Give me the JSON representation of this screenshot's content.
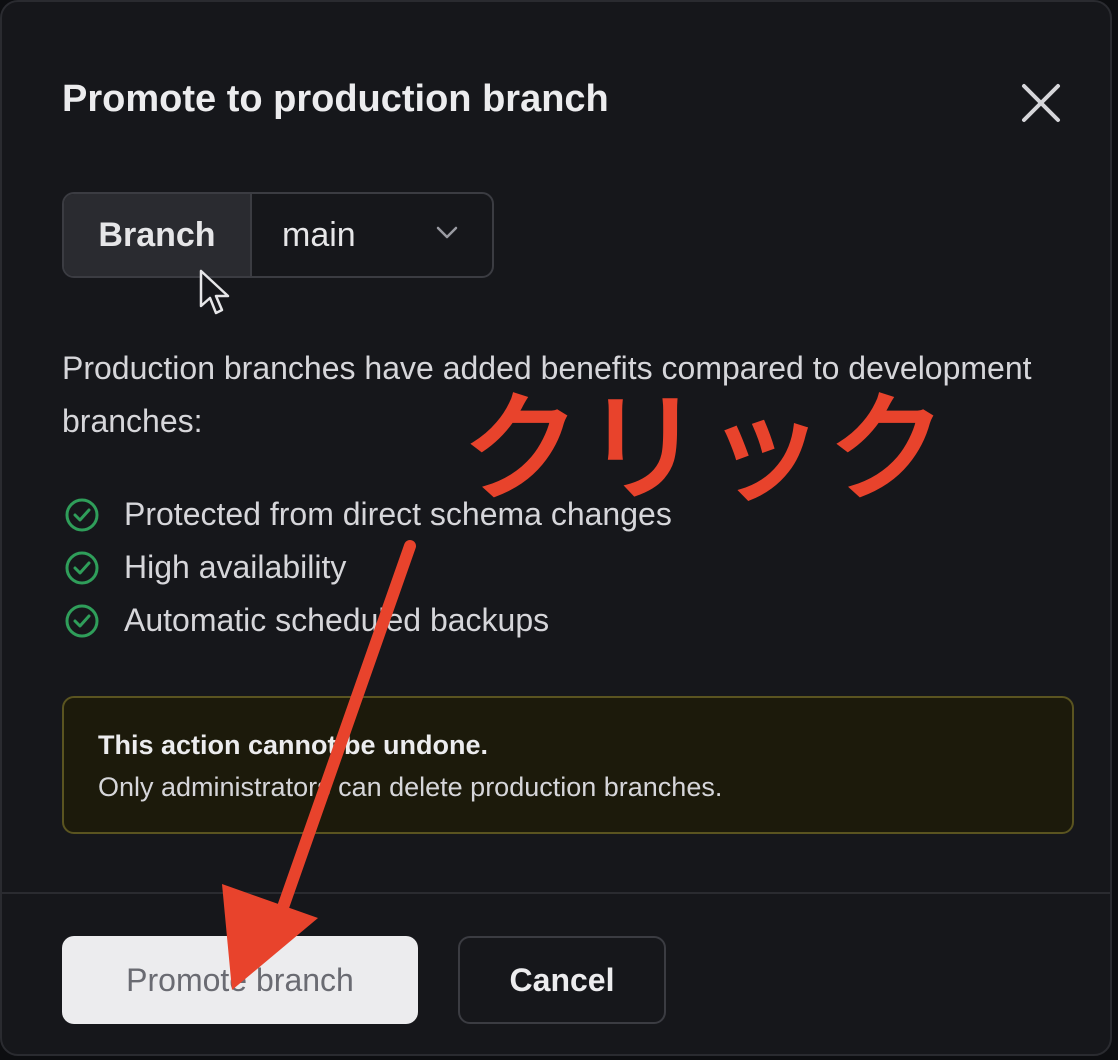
{
  "dialog": {
    "title": "Promote to production branch",
    "close_icon": "close-icon"
  },
  "branch_selector": {
    "label": "Branch",
    "value": "main",
    "dropdown_icon": "chevron-down-icon"
  },
  "description": "Production branches have added benefits compared to development branches:",
  "benefits": [
    {
      "icon": "check-circle-icon",
      "text": "Protected from direct schema changes"
    },
    {
      "icon": "check-circle-icon",
      "text": "High availability"
    },
    {
      "icon": "check-circle-icon",
      "text": "Automatic scheduled backups"
    }
  ],
  "warning": {
    "title": "This action cannot be undone.",
    "body": "Only administrators can delete production branches."
  },
  "footer": {
    "promote_label": "Promote branch",
    "cancel_label": "Cancel"
  },
  "annotation": {
    "text": "クリック",
    "color": "#e8432c",
    "arrow_icon": "arrow-icon"
  },
  "colors": {
    "check_icon": "#2f9e5a",
    "warning_border": "#5a5420",
    "warning_bg": "#1c1a0b"
  }
}
